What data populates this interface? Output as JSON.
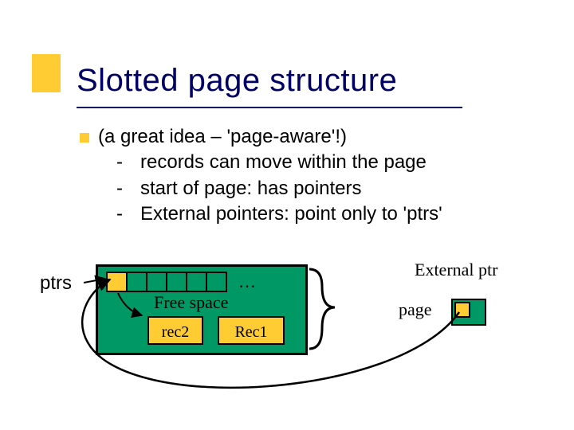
{
  "title": "Slotted page structure",
  "body": {
    "lead": "(a great idea – 'page-aware'!)",
    "bullets": [
      "records can move within the page",
      "start of page: has pointers",
      "External pointers: point only to 'ptrs'"
    ]
  },
  "diagram": {
    "ptrs_label": "ptrs",
    "ellipsis": "…",
    "free_space": "Free space",
    "rec2": "rec2",
    "rec1": "Rec1",
    "external_ptr_label": "External ptr",
    "page_label": "page"
  }
}
